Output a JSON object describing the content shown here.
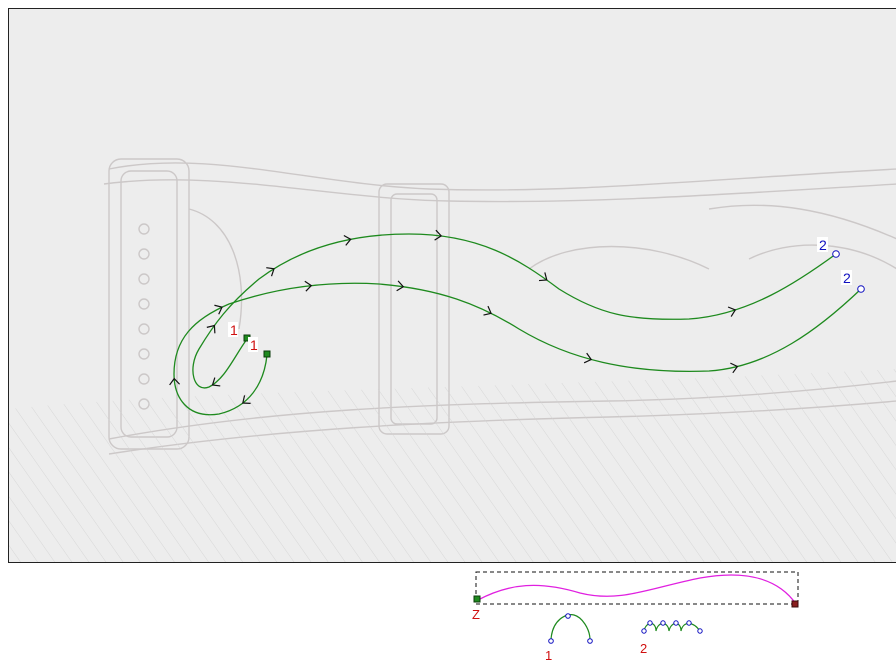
{
  "canvas": {
    "background_color": "#ececec",
    "curve_color": "#1e8a1e",
    "label_start_color": "#d01010",
    "label_end_color": "#1010c0",
    "labels": {
      "outer_start": "1",
      "inner_start": "1",
      "outer_end": "2",
      "inner_end": "2"
    }
  },
  "preview": {
    "curve_color": "#e020e0",
    "start_label": "Z",
    "label_color": "#d01010"
  },
  "options": [
    {
      "label": "1",
      "icon": "single-arch-icon"
    },
    {
      "label": "2",
      "icon": "loops-icon"
    }
  ]
}
